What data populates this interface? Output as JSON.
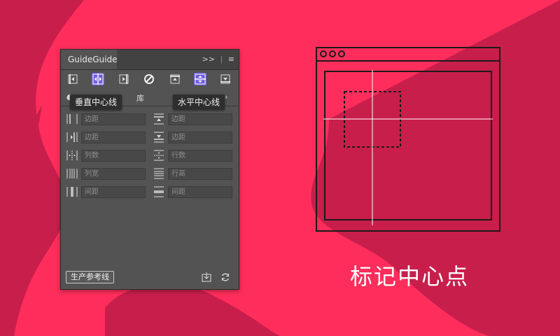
{
  "panel": {
    "title": "GuideGuide",
    "menu_glyphs": [
      ">>",
      "|",
      "≡"
    ],
    "subtab_library": "库"
  },
  "tooltips": {
    "vertical_midline": "垂直中心线",
    "horizontal_midline": "水平中心线"
  },
  "fields": {
    "left": [
      "边距",
      "边距",
      "列数",
      "列宽",
      "间距"
    ],
    "right": [
      "边距",
      "边距",
      "行数",
      "行高",
      "间距"
    ]
  },
  "bottom": {
    "generate_label": "生产参考线"
  },
  "caption": "标记中心点",
  "colors": {
    "background": "#ff2d5b",
    "background_dark": "#c81e4b",
    "panel": "#535353",
    "accent": "#6f5fd8"
  }
}
